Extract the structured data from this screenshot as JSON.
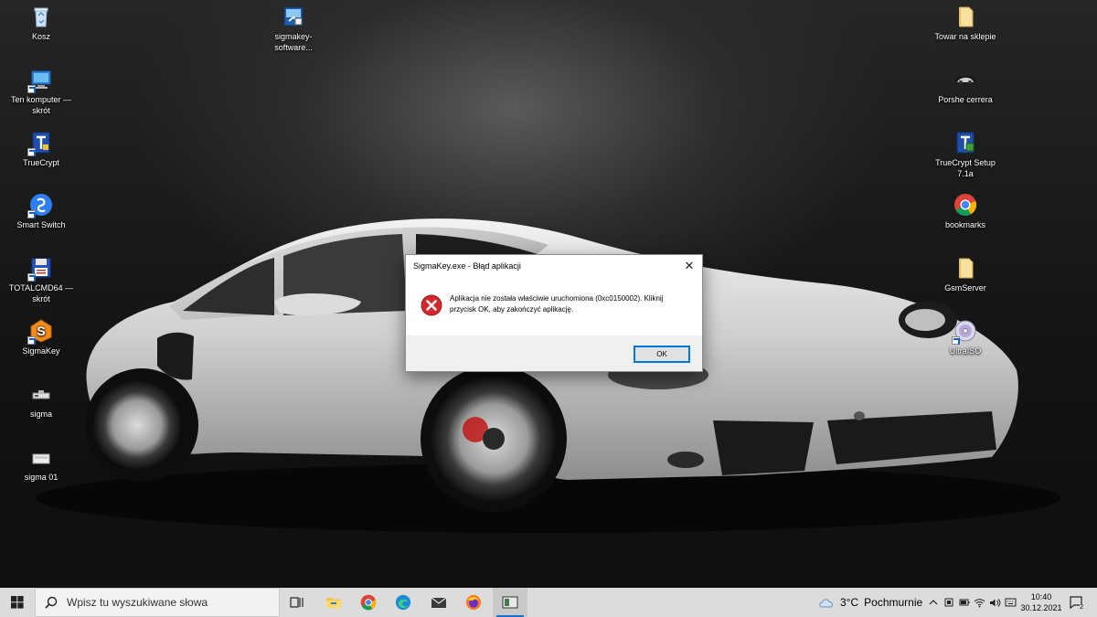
{
  "desktop": {
    "left_icons": [
      {
        "name": "recycle-bin",
        "label": "Kosz",
        "icon": "recycle-bin-icon"
      },
      {
        "name": "this-pc",
        "label": "Ten komputer — skrót",
        "icon": "computer-icon"
      },
      {
        "name": "truecrypt",
        "label": "TrueCrypt",
        "icon": "truecrypt-icon"
      },
      {
        "name": "smart-switch",
        "label": "Smart Switch",
        "icon": "smart-switch-icon"
      },
      {
        "name": "totalcmd",
        "label": "TOTALCMD64 — skrót",
        "icon": "floppy-icon"
      },
      {
        "name": "sigmakey",
        "label": "SigmaKey",
        "icon": "sigmakey-icon"
      },
      {
        "name": "sigma",
        "label": "sigma",
        "icon": "device-icon"
      },
      {
        "name": "sigma-01",
        "label": "sigma 01",
        "icon": "device-icon"
      }
    ],
    "top_icon": {
      "name": "sigmakey-software",
      "label": "sigmakey-software...",
      "icon": "installer-icon"
    },
    "right_icons": [
      {
        "name": "towar-na-sklepie",
        "label": "Towar na sklepie",
        "icon": "folder-icon"
      },
      {
        "name": "porshe-cerrera",
        "label": "Porshe cerrera",
        "icon": "car-image-icon"
      },
      {
        "name": "truecrypt-setup",
        "label": "TrueCrypt Setup 7.1a",
        "icon": "truecrypt-setup-icon"
      },
      {
        "name": "bookmarks",
        "label": "bookmarks",
        "icon": "chrome-icon"
      },
      {
        "name": "gsmserver",
        "label": "GsmServer",
        "icon": "folder-icon"
      },
      {
        "name": "ultraiso",
        "label": "UltraISO",
        "icon": "ultraiso-icon"
      }
    ]
  },
  "dialog": {
    "title": "SigmaKey.exe - Błąd aplikacji",
    "message": "Aplikacja nie została właściwie uruchomiona (0xc0150002). Kliknij przycisk OK, aby zakończyć aplikację.",
    "ok_label": "OK",
    "close_glyph": "✕"
  },
  "taskbar": {
    "search_placeholder": "Wpisz tu wyszukiwane słowa",
    "pinned": [
      "task-view-icon",
      "file-explorer-icon",
      "chrome-icon",
      "edge-icon",
      "mail-icon",
      "firefox-icon",
      "sigmakey-app-icon"
    ],
    "weather": {
      "temp": "3°C",
      "condition": "Pochmurnie"
    },
    "clock": {
      "time": "10:40",
      "date": "30.12.2021"
    },
    "notification_count": "2"
  },
  "colors": {
    "accent": "#0078d7",
    "error_red": "#d2282e",
    "taskbar": "#dcdcdc"
  }
}
